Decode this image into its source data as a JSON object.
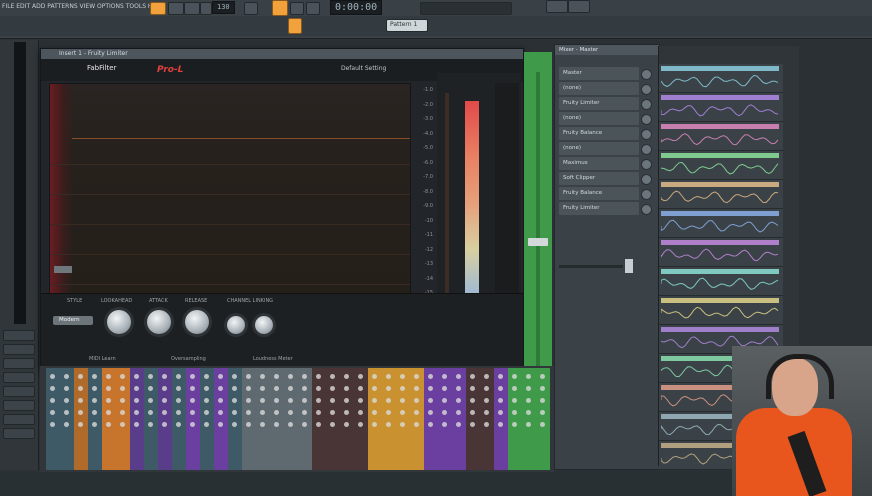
{
  "toolbar": {
    "menu_text": "FILE EDIT ADD PATTERNS VIEW OPTIONS TOOLS HELP",
    "time_display": "0:00:00",
    "tempo_display": "130",
    "pattern_label": "Pattern 1"
  },
  "plugin": {
    "window_title": "Insert 1 - Fruity Limiter",
    "brand_text": "FabFilter",
    "product_text": "Pro-L",
    "preset_text": "Default Setting",
    "db_scale": [
      "-1.0",
      "-2.0",
      "-3.0",
      "-4.0",
      "-5.0",
      "-6.0",
      "-7.0",
      "-8.0",
      "-9.0",
      "-10",
      "-11",
      "-12",
      "-13",
      "-14",
      "-15"
    ],
    "controls": {
      "style_label": "STYLE",
      "style_value": "Modern",
      "lookahead_label": "LOOKAHEAD",
      "attack_label": "ATTACK",
      "release_label": "RELEASE",
      "channel_link_label": "CHANNEL LINKING"
    },
    "footer_left": "MIDI Learn",
    "footer_mid": "Oversampling",
    "footer_right": "Loudness Meter"
  },
  "channels": {
    "panel_title": "Mixer - Master",
    "items": [
      "Master",
      "(none)",
      "Fruity Limiter",
      "(none)",
      "Fruity Balance",
      "(none)",
      "Maximus",
      "Soft Clipper",
      "Fruity Balance",
      "Fruity Limiter"
    ]
  },
  "colors": {
    "accent_orange": "#f2a23c",
    "green_strip": "#3f9b49",
    "limiter_red": "#e0403b"
  }
}
